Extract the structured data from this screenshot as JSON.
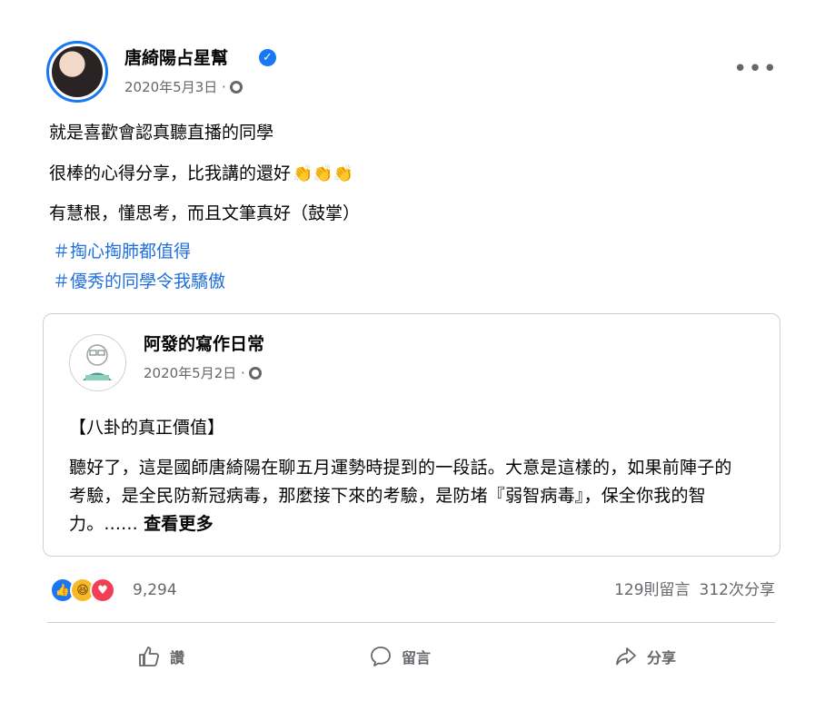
{
  "post": {
    "author": "唐綺陽占星幫",
    "date": "2020年5月3日 ·",
    "lines": [
      "就是喜歡會認真聽直播的同學",
      "很棒的心得分享，比我講的還好",
      "有慧根，懂思考，而且文筆真好（鼓掌）"
    ],
    "claps": "👏👏👏",
    "hashtags": [
      "＃掏心掏肺都值得",
      "＃優秀的同學令我驕傲"
    ],
    "more_label": "•••"
  },
  "shared": {
    "author": "阿發的寫作日常",
    "date": "2020年5月2日 ·",
    "title": "【八卦的真正價值】",
    "body": "聽好了，這是國師唐綺陽在聊五月運勢時提到的一段話。大意是這樣的，如果前陣子的考驗，是全民防新冠病毒，那麼接下來的考驗，是防堵『弱智病毒』，保全你我的智力。...... ",
    "see_more": "查看更多"
  },
  "engagement": {
    "reaction_count": "9,294",
    "comments": "129則留言",
    "shares": "312次分享"
  },
  "actions": {
    "like": "讚",
    "comment": "留言",
    "share": "分享"
  },
  "icons": {
    "verified": "check-badge-icon",
    "globe": "globe-icon",
    "like": "thumbs-up-icon",
    "comment": "comment-bubble-icon",
    "share": "share-arrow-icon"
  },
  "colors": {
    "accent": "#1877f2",
    "hashtag": "#216fdb",
    "secondary_text": "#65676b"
  }
}
